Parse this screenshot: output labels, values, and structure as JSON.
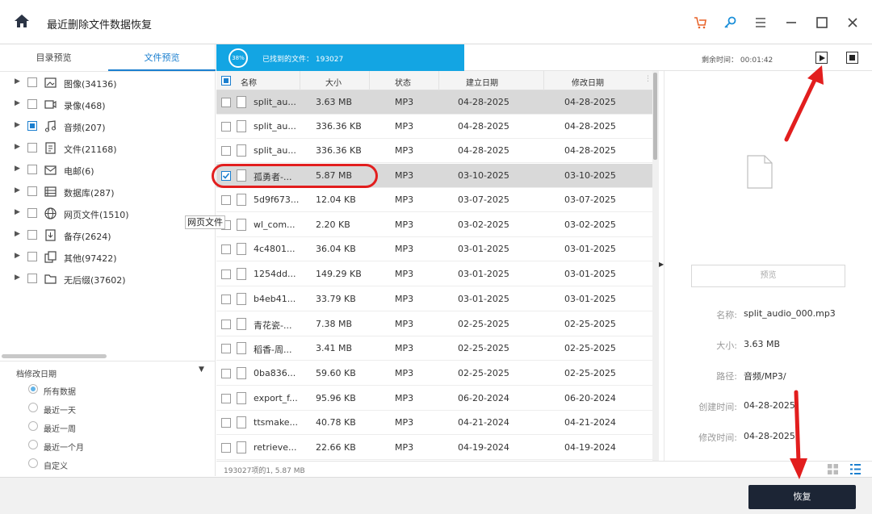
{
  "window": {
    "title": "最近删除文件数据恢复"
  },
  "left_panel": {
    "tabs": [
      {
        "label": "目录预览",
        "active": false
      },
      {
        "label": "文件预览",
        "active": true
      }
    ],
    "tree": [
      {
        "label": "图像(34136)",
        "icon": "image-icon",
        "checked": false
      },
      {
        "label": "录像(468)",
        "icon": "video-icon",
        "checked": false
      },
      {
        "label": "音频(207)",
        "icon": "music-icon",
        "checked": true
      },
      {
        "label": "文件(21168)",
        "icon": "document-icon",
        "checked": false
      },
      {
        "label": "电邮(6)",
        "icon": "email-icon",
        "checked": false
      },
      {
        "label": "数据库(287)",
        "icon": "database-icon",
        "checked": false
      },
      {
        "label": "网页文件(1510)",
        "icon": "globe-icon",
        "checked": false
      },
      {
        "label": "备存(2624)",
        "icon": "backup-icon",
        "checked": false
      },
      {
        "label": "其他(97422)",
        "icon": "other-icon",
        "checked": false
      },
      {
        "label": "无后缀(37602)",
        "icon": "folder-icon",
        "checked": false
      }
    ],
    "filter": {
      "title": "档修改日期",
      "options": [
        {
          "label": "所有数据",
          "selected": true
        },
        {
          "label": "最近一天",
          "selected": false
        },
        {
          "label": "最近一周",
          "selected": false
        },
        {
          "label": "最近一个月",
          "selected": false
        },
        {
          "label": "自定义",
          "selected": false
        }
      ]
    }
  },
  "scan": {
    "progress_label": "38%",
    "progress_fraction": 0.38,
    "found_text": "已找到的文件： 193027",
    "remaining_text": "剩余时间： 00:01:42"
  },
  "table": {
    "headers": {
      "name": "名称",
      "size": "大小",
      "status": "状态",
      "created": "建立日期",
      "modified": "修改日期"
    },
    "rows": [
      {
        "name": "split_au...",
        "size": "3.63  MB",
        "status": "MP3",
        "created": "04-28-2025",
        "modified": "04-28-2025",
        "checked": false,
        "selected": true
      },
      {
        "name": "split_au...",
        "size": "336.36 KB",
        "status": "MP3",
        "created": "04-28-2025",
        "modified": "04-28-2025",
        "checked": false,
        "selected": false
      },
      {
        "name": "split_au...",
        "size": "336.36 KB",
        "status": "MP3",
        "created": "04-28-2025",
        "modified": "04-28-2025",
        "checked": false,
        "selected": false
      },
      {
        "name": "孤勇者-...",
        "size": "5.87  MB",
        "status": "MP3",
        "created": "03-10-2025",
        "modified": "03-10-2025",
        "checked": true,
        "selected": true
      },
      {
        "name": "5d9f673...",
        "size": "12.04 KB",
        "status": "MP3",
        "created": "03-07-2025",
        "modified": "03-07-2025",
        "checked": false,
        "selected": false
      },
      {
        "name": "wl_com...",
        "size": "2.20 KB",
        "status": "MP3",
        "created": "03-02-2025",
        "modified": "03-02-2025",
        "checked": false,
        "selected": false
      },
      {
        "name": "4c4801...",
        "size": "36.04 KB",
        "status": "MP3",
        "created": "03-01-2025",
        "modified": "03-01-2025",
        "checked": false,
        "selected": false
      },
      {
        "name": "1254dd...",
        "size": "149.29 KB",
        "status": "MP3",
        "created": "03-01-2025",
        "modified": "03-01-2025",
        "checked": false,
        "selected": false
      },
      {
        "name": "b4eb41...",
        "size": "33.79 KB",
        "status": "MP3",
        "created": "03-01-2025",
        "modified": "03-01-2025",
        "checked": false,
        "selected": false
      },
      {
        "name": "青花瓷-...",
        "size": "7.38  MB",
        "status": "MP3",
        "created": "02-25-2025",
        "modified": "02-25-2025",
        "checked": false,
        "selected": false
      },
      {
        "name": "稻香-周...",
        "size": "3.41  MB",
        "status": "MP3",
        "created": "02-25-2025",
        "modified": "02-25-2025",
        "checked": false,
        "selected": false
      },
      {
        "name": "0ba836...",
        "size": "59.60 KB",
        "status": "MP3",
        "created": "02-25-2025",
        "modified": "02-25-2025",
        "checked": false,
        "selected": false
      },
      {
        "name": "export_f...",
        "size": "95.96 KB",
        "status": "MP3",
        "created": "06-20-2024",
        "modified": "06-20-2024",
        "checked": false,
        "selected": false
      },
      {
        "name": "ttsmake...",
        "size": "40.78 KB",
        "status": "MP3",
        "created": "04-21-2024",
        "modified": "04-21-2024",
        "checked": false,
        "selected": false
      },
      {
        "name": "retrieve...",
        "size": "22.66 KB",
        "status": "MP3",
        "created": "04-19-2024",
        "modified": "04-19-2024",
        "checked": false,
        "selected": false
      }
    ],
    "footer": "193027项的1, 5.87  MB"
  },
  "tooltip": "网页文件",
  "details": {
    "preview_button": "预览",
    "name_label": "名称:",
    "name_value": "split_audio_000.mp3",
    "size_label": "大小:",
    "size_value": "3.63  MB",
    "path_label": "路径:",
    "path_value": "音频/MP3/",
    "created_label": "创建时间:",
    "created_value": "04-28-2025",
    "modified_label": "修改时间:",
    "modified_value": "04-28-2025"
  },
  "bottom": {
    "recover_label": "恢复"
  },
  "colors": {
    "accent": "#13a5e3",
    "primary_button": "#1c2535",
    "annotation": "#e21e1e"
  }
}
